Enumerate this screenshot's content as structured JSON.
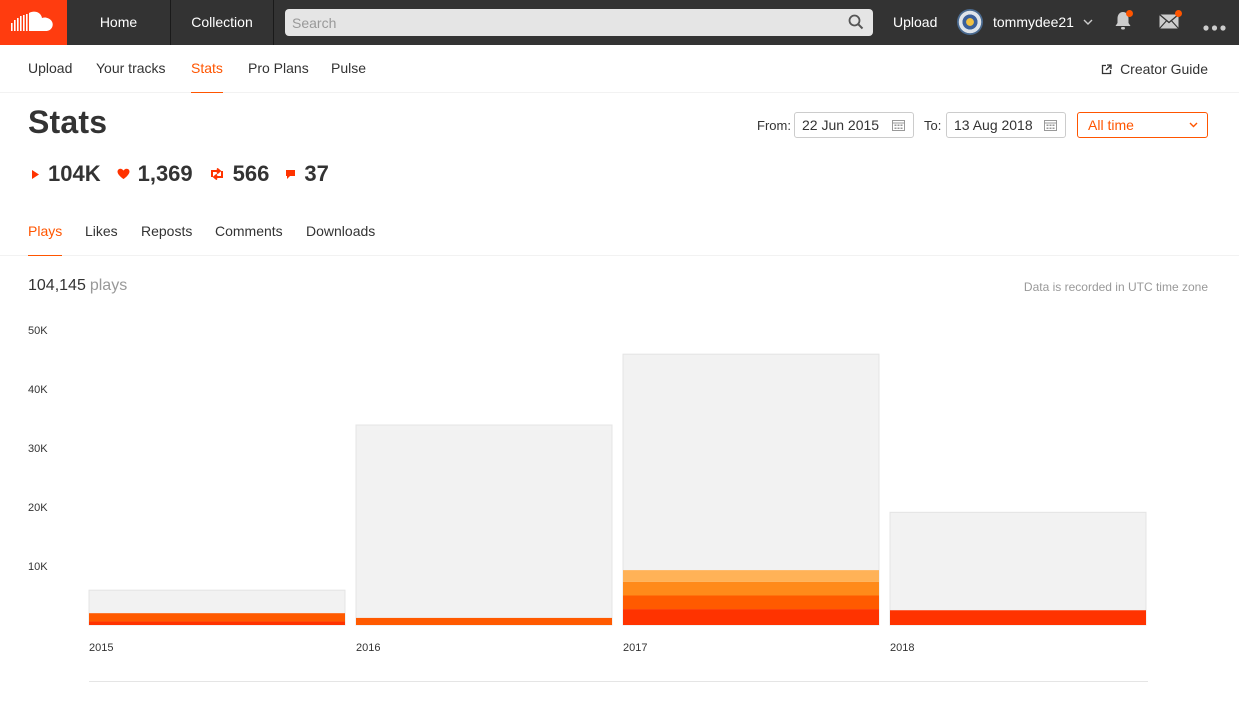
{
  "header": {
    "logo": "soundcloud-logo",
    "nav": {
      "home": "Home",
      "collection": "Collection"
    },
    "search": {
      "placeholder": "Search",
      "value": ""
    },
    "upload": "Upload",
    "user": {
      "name": "tommydee21"
    },
    "icons": [
      "bell-icon",
      "mail-icon",
      "more-icon"
    ],
    "colors": {
      "bar": "#333333",
      "brand": "#ff3c0f",
      "notify": "#ff5500"
    }
  },
  "subnav": {
    "items": [
      {
        "label": "Upload"
      },
      {
        "label": "Your tracks"
      },
      {
        "label": "Stats",
        "active": true
      },
      {
        "label": "Pro Plans"
      },
      {
        "label": "Pulse"
      }
    ],
    "creator_guide": "Creator Guide"
  },
  "stats": {
    "title": "Stats",
    "from_label": "From:",
    "from_value": "22 Jun 2015",
    "to_label": "To:",
    "to_value": "13 Aug 2018",
    "range": "All time",
    "totals": {
      "plays": "104K",
      "likes": "1,369",
      "reposts": "566",
      "comments": "37"
    }
  },
  "tabs": [
    {
      "label": "Plays",
      "active": true
    },
    {
      "label": "Likes"
    },
    {
      "label": "Reposts"
    },
    {
      "label": "Comments"
    },
    {
      "label": "Downloads"
    }
  ],
  "plays_summary": {
    "count": "104,145",
    "unit": "plays"
  },
  "timezone_note": "Data is recorded in UTC time zone",
  "chart_data": {
    "type": "bar",
    "categories": [
      "2015",
      "2016",
      "2017",
      "2018"
    ],
    "ylim": [
      0,
      50000
    ],
    "yticks": [
      10000,
      20000,
      30000,
      40000,
      50000
    ],
    "ytick_labels": [
      "10K",
      "20K",
      "30K",
      "40K",
      "50K"
    ],
    "background_totals": [
      5900,
      33900,
      45900,
      19100
    ],
    "series": [
      {
        "color": "#ff3300",
        "values": [
          600,
          0,
          2700,
          2500
        ]
      },
      {
        "color": "#ff5a00",
        "values": [
          1400,
          1200,
          2300,
          0
        ]
      },
      {
        "color": "#ff8a1a",
        "values": [
          0,
          0,
          2300,
          0
        ]
      },
      {
        "color": "#ffb257",
        "values": [
          0,
          0,
          2000,
          0
        ]
      }
    ],
    "background_color": "#f2f2f2",
    "grid": false
  }
}
